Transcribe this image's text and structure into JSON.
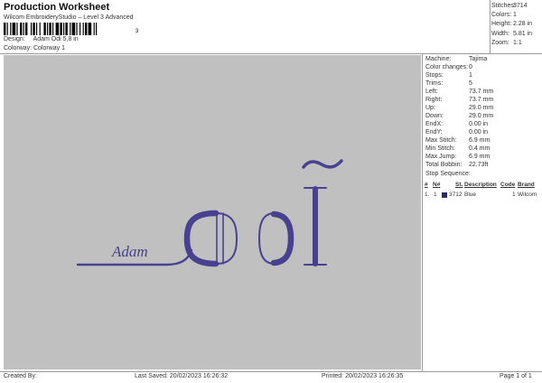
{
  "header": {
    "title": "Production Worksheet",
    "subtitle": "Wilcom EmbroideryStudio – Level 3 Advanced",
    "barcode_number": "3"
  },
  "info": {
    "design_label": "Design:",
    "design_value": "Adam Odi 5,8 in",
    "colorway_label": "Colorway:",
    "colorway_value": "Colorway 1"
  },
  "top_stats": [
    {
      "label": "Stitches:",
      "value": "3714"
    },
    {
      "label": "Colors:",
      "value": "1"
    },
    {
      "label": "Height:",
      "value": "2.28 in"
    },
    {
      "label": "Width:",
      "value": "5.81 in"
    },
    {
      "label": "Zoom:",
      "value": "1:1"
    }
  ],
  "machine_stats": [
    {
      "label": "Machine:",
      "value": "Tajima"
    },
    {
      "label": "Color changes:",
      "value": "0"
    },
    {
      "label": "Stops:",
      "value": "1"
    },
    {
      "label": "Trims:",
      "value": "5"
    },
    {
      "label": "Left:",
      "value": "73.7 mm"
    },
    {
      "label": "Right:",
      "value": "73.7 mm"
    },
    {
      "label": "Up:",
      "value": "29.0 mm"
    },
    {
      "label": "Down:",
      "value": "29.0 mm"
    },
    {
      "label": "EndX:",
      "value": "0.00 in"
    },
    {
      "label": "EndY:",
      "value": "0.00 in"
    },
    {
      "label": "Max Stitch:",
      "value": "6.9 mm"
    },
    {
      "label": "Min Stitch:",
      "value": "0.4 mm"
    },
    {
      "label": "Max Jump:",
      "value": "6.9 mm"
    },
    {
      "label": "Total Bobbin:",
      "value": "22.73ft"
    }
  ],
  "stop_sequence": {
    "title": "Stop Sequence:",
    "headers": [
      "#",
      "N#",
      "St.",
      "Description",
      "Code",
      "Brand"
    ],
    "rows": [
      {
        "index": "1.",
        "needle": "1",
        "stitches": "3712",
        "description": "Blue",
        "code": "1",
        "brand": "Wilcom",
        "color": "#2c2a6b"
      }
    ]
  },
  "design": {
    "text_small": "Adam",
    "thread_color": "#47418f",
    "background_color": "#c0c0c0"
  },
  "footer": {
    "created_by": "Created By:",
    "last_saved": "Last Saved: 20/02/2023 16:26:32",
    "printed": "Printed: 20/02/2023 16:26:35",
    "page": "Page 1 of 1"
  }
}
